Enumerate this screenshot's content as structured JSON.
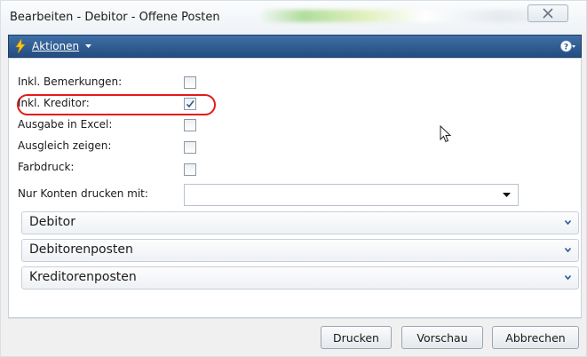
{
  "window": {
    "title": "Bearbeiten - Debitor - Offene Posten"
  },
  "actionbar": {
    "actions_label": "Aktionen"
  },
  "options": [
    {
      "label": "Inkl. Bemerkungen:",
      "checked": false
    },
    {
      "label": "Inkl. Kreditor:",
      "checked": true
    },
    {
      "label": "Ausgabe in Excel:",
      "checked": false
    },
    {
      "label": "Ausgleich zeigen:",
      "checked": false
    },
    {
      "label": "Farbdruck:",
      "checked": false
    }
  ],
  "nur_konten": {
    "label": "Nur Konten drucken mit:",
    "value": ""
  },
  "fasttabs": [
    {
      "label": "Debitor"
    },
    {
      "label": "Debitorenposten"
    },
    {
      "label": "Kreditorenposten"
    }
  ],
  "buttons": {
    "print": "Drucken",
    "preview": "Vorschau",
    "cancel": "Abbrechen"
  },
  "colors": {
    "actionbar": "#2f5e95",
    "highlight": "#e31a1a"
  },
  "icons": {
    "actions": "lightning-bolt-icon",
    "help": "help-circle-icon",
    "close": "close-icon"
  }
}
